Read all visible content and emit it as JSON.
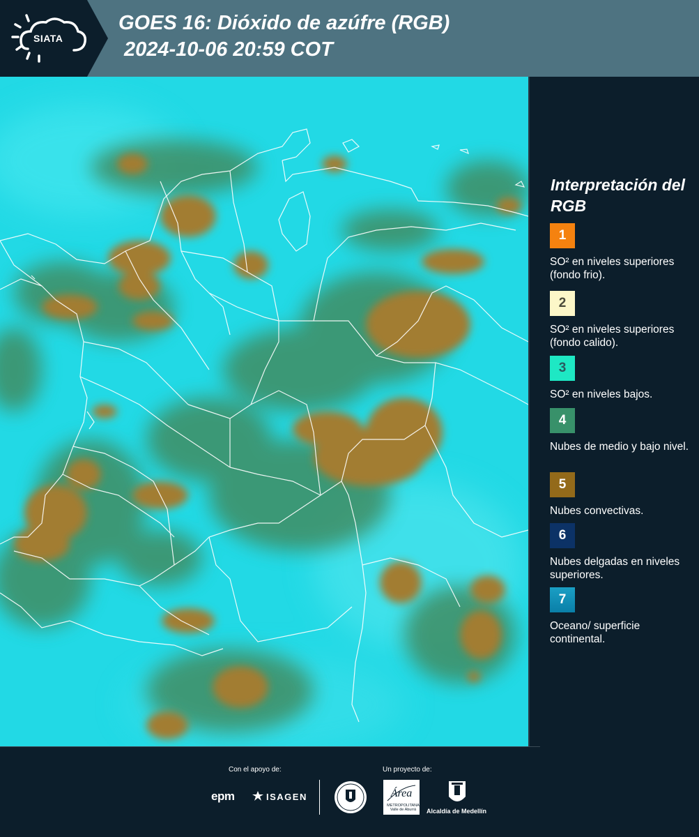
{
  "header": {
    "logo_text": "SIATA",
    "title_line1": "GOES 16: Dióxido de azúfre (RGB)",
    "title_line2": "2024-10-06 20:59 COT"
  },
  "legend": {
    "title": "Interpretación del RGB",
    "items": [
      {
        "number": "1",
        "color": "#f5820f",
        "text": "SO² en niveles superiores (fondo frio)."
      },
      {
        "number": "2",
        "color": "#fcf7c8",
        "text": "SO² en niveles superiores (fondo calido)."
      },
      {
        "number": "3",
        "color": "#1ee8c4",
        "text": "SO² en niveles bajos."
      },
      {
        "number": "4",
        "color": "#38916a",
        "text": "Nubes de medio y bajo nivel."
      },
      {
        "number": "5",
        "color": "#936a1a",
        "text": "Nubes convectivas."
      },
      {
        "number": "6",
        "color": "#0c3266",
        "text": "Nubes delgadas en niveles superiores."
      },
      {
        "number": "7",
        "color": "#0b8fb8",
        "text": "Oceano/ superficie continental."
      }
    ]
  },
  "footer": {
    "support_label": "Con el apoyo de:",
    "project_label": "Un proyecto de:",
    "sponsor_epm": "epm",
    "sponsor_isagen": "ISAGEN",
    "metro_text": "METROPOLITANA Valle de Aburrá",
    "alcaldia_text": "Alcaldía de Medellín"
  },
  "colors": {
    "header_bg": "#4e7381",
    "page_bg": "#0c1e2b",
    "map_cyan": "#1fd8e6",
    "cloud_green": "#3f8a5e",
    "cloud_brown": "#9e7b2c"
  }
}
